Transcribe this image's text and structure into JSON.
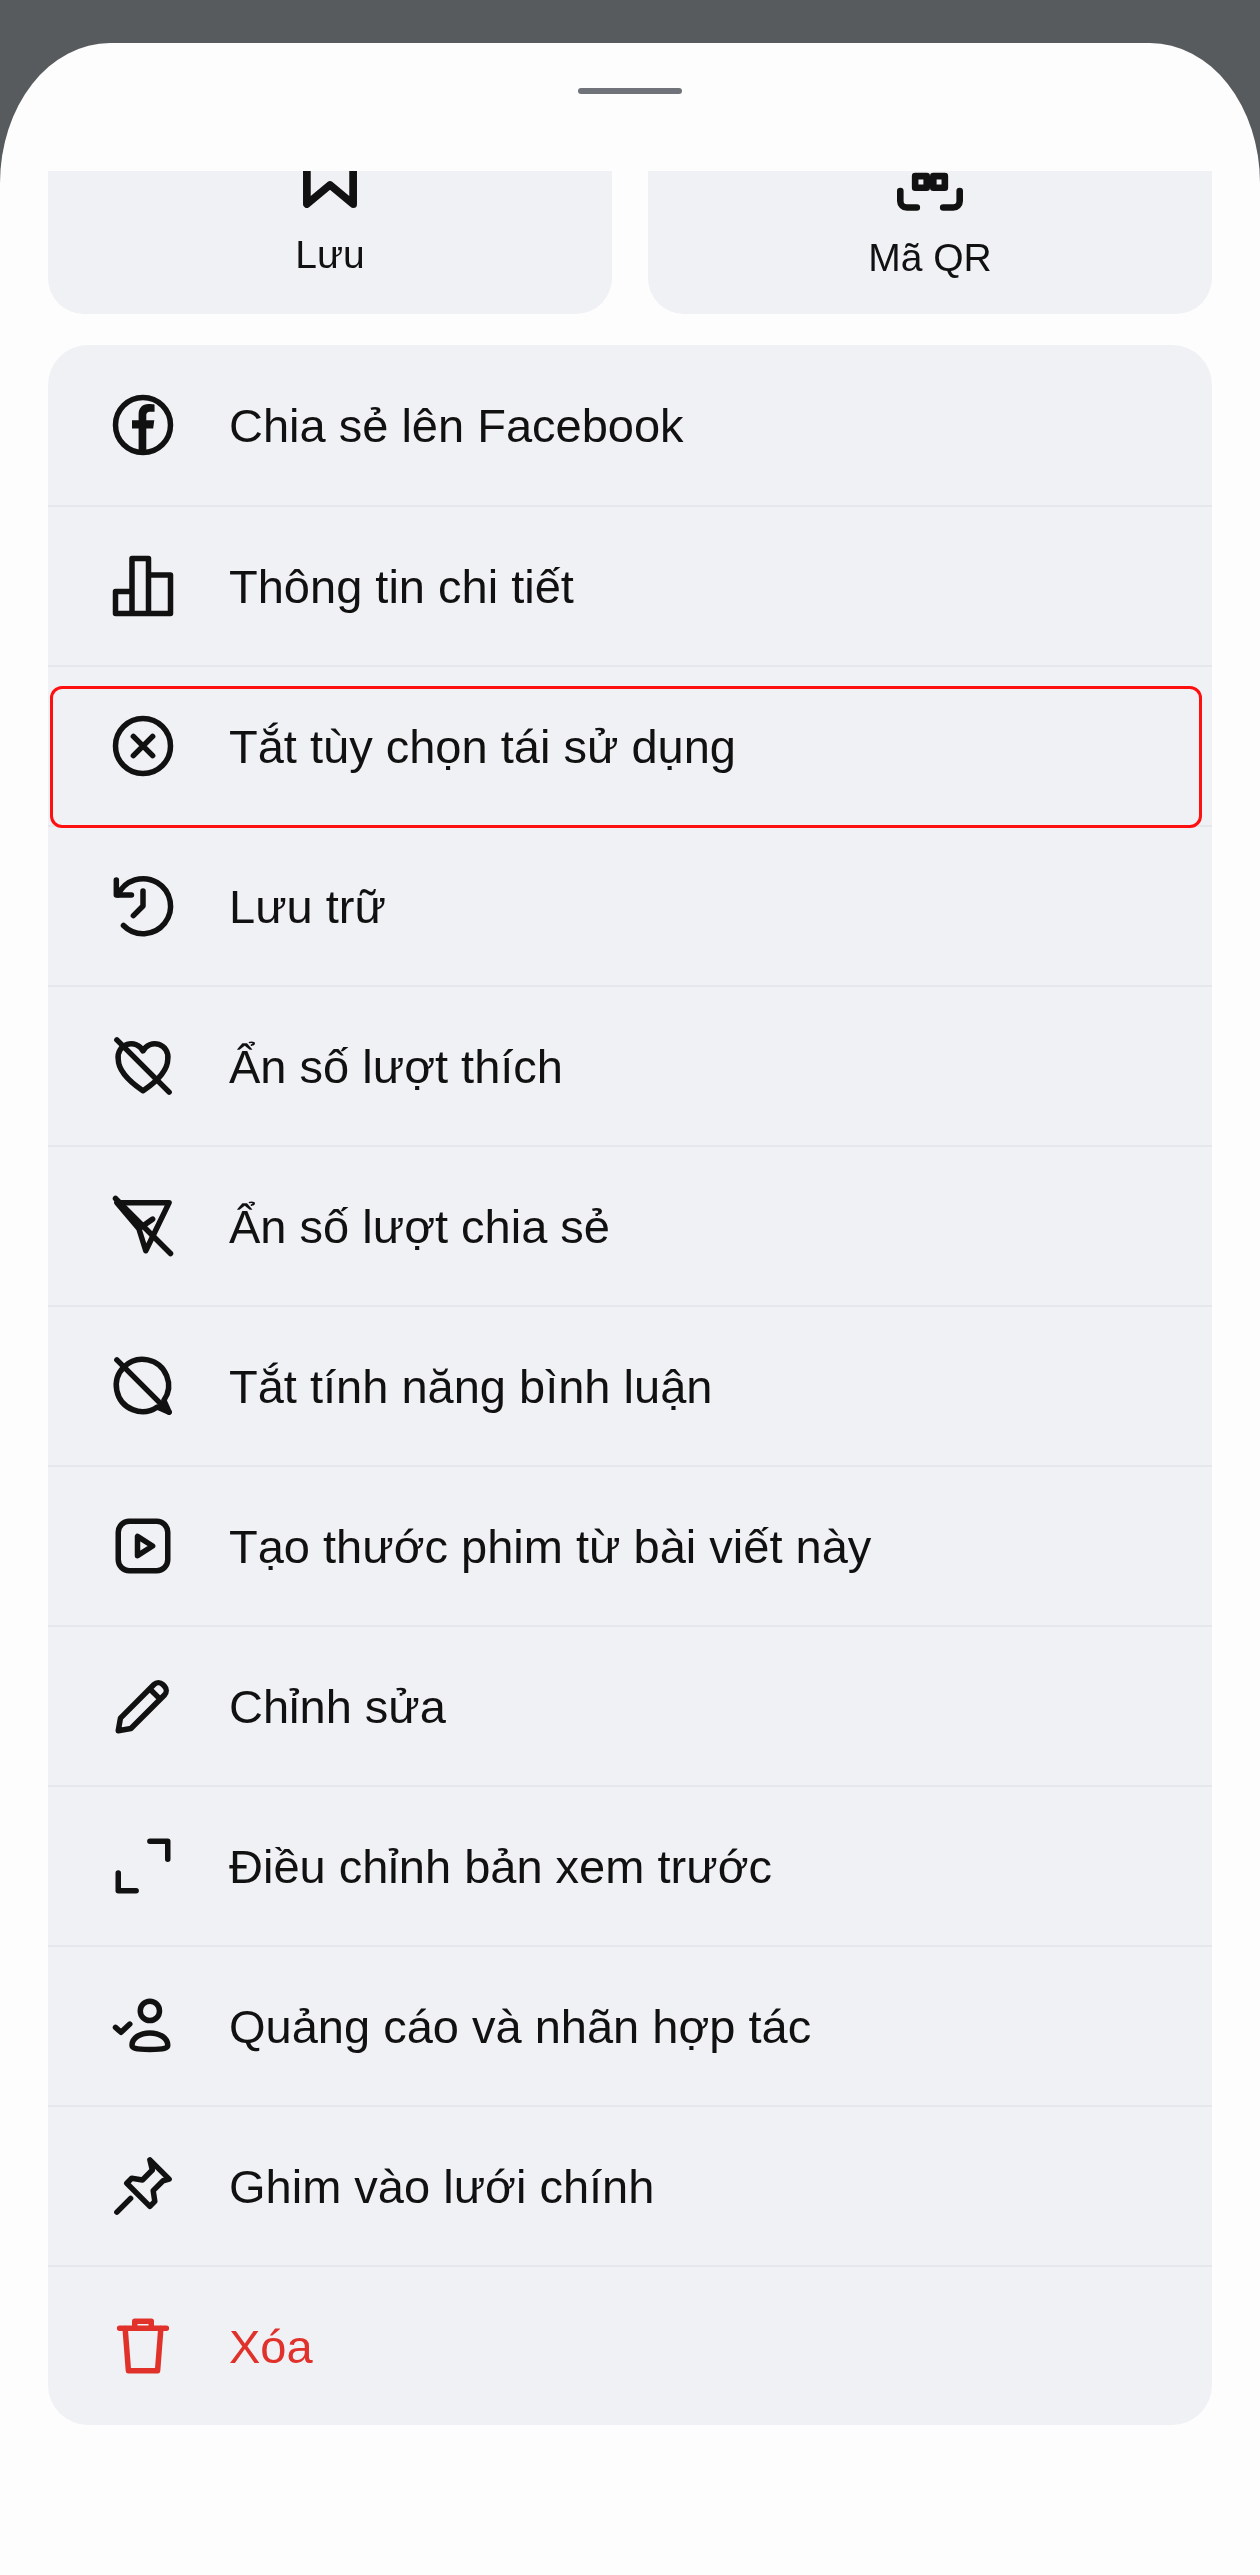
{
  "sheet": {
    "tiles": [
      {
        "label": "Lưu"
      },
      {
        "label": "Mã QR"
      }
    ],
    "items": [
      {
        "label": "Chia sẻ lên Facebook",
        "destructive": false,
        "highlighted": false
      },
      {
        "label": "Thông tin chi tiết",
        "destructive": false,
        "highlighted": false
      },
      {
        "label": "Tắt tùy chọn tái sử dụng",
        "destructive": false,
        "highlighted": true
      },
      {
        "label": "Lưu trữ",
        "destructive": false,
        "highlighted": false
      },
      {
        "label": "Ẩn số lượt thích",
        "destructive": false,
        "highlighted": false
      },
      {
        "label": "Ẩn số lượt chia sẻ",
        "destructive": false,
        "highlighted": false
      },
      {
        "label": "Tắt tính năng bình luận",
        "destructive": false,
        "highlighted": false
      },
      {
        "label": "Tạo thước phim từ bài viết này",
        "destructive": false,
        "highlighted": false
      },
      {
        "label": "Chỉnh sửa",
        "destructive": false,
        "highlighted": false
      },
      {
        "label": "Điều chỉnh bản xem trước",
        "destructive": false,
        "highlighted": false
      },
      {
        "label": "Quảng cáo và nhãn hợp tác",
        "destructive": false,
        "highlighted": false
      },
      {
        "label": "Ghim vào lưới chính",
        "destructive": false,
        "highlighted": false
      },
      {
        "label": "Xóa",
        "destructive": true,
        "highlighted": false
      }
    ]
  }
}
